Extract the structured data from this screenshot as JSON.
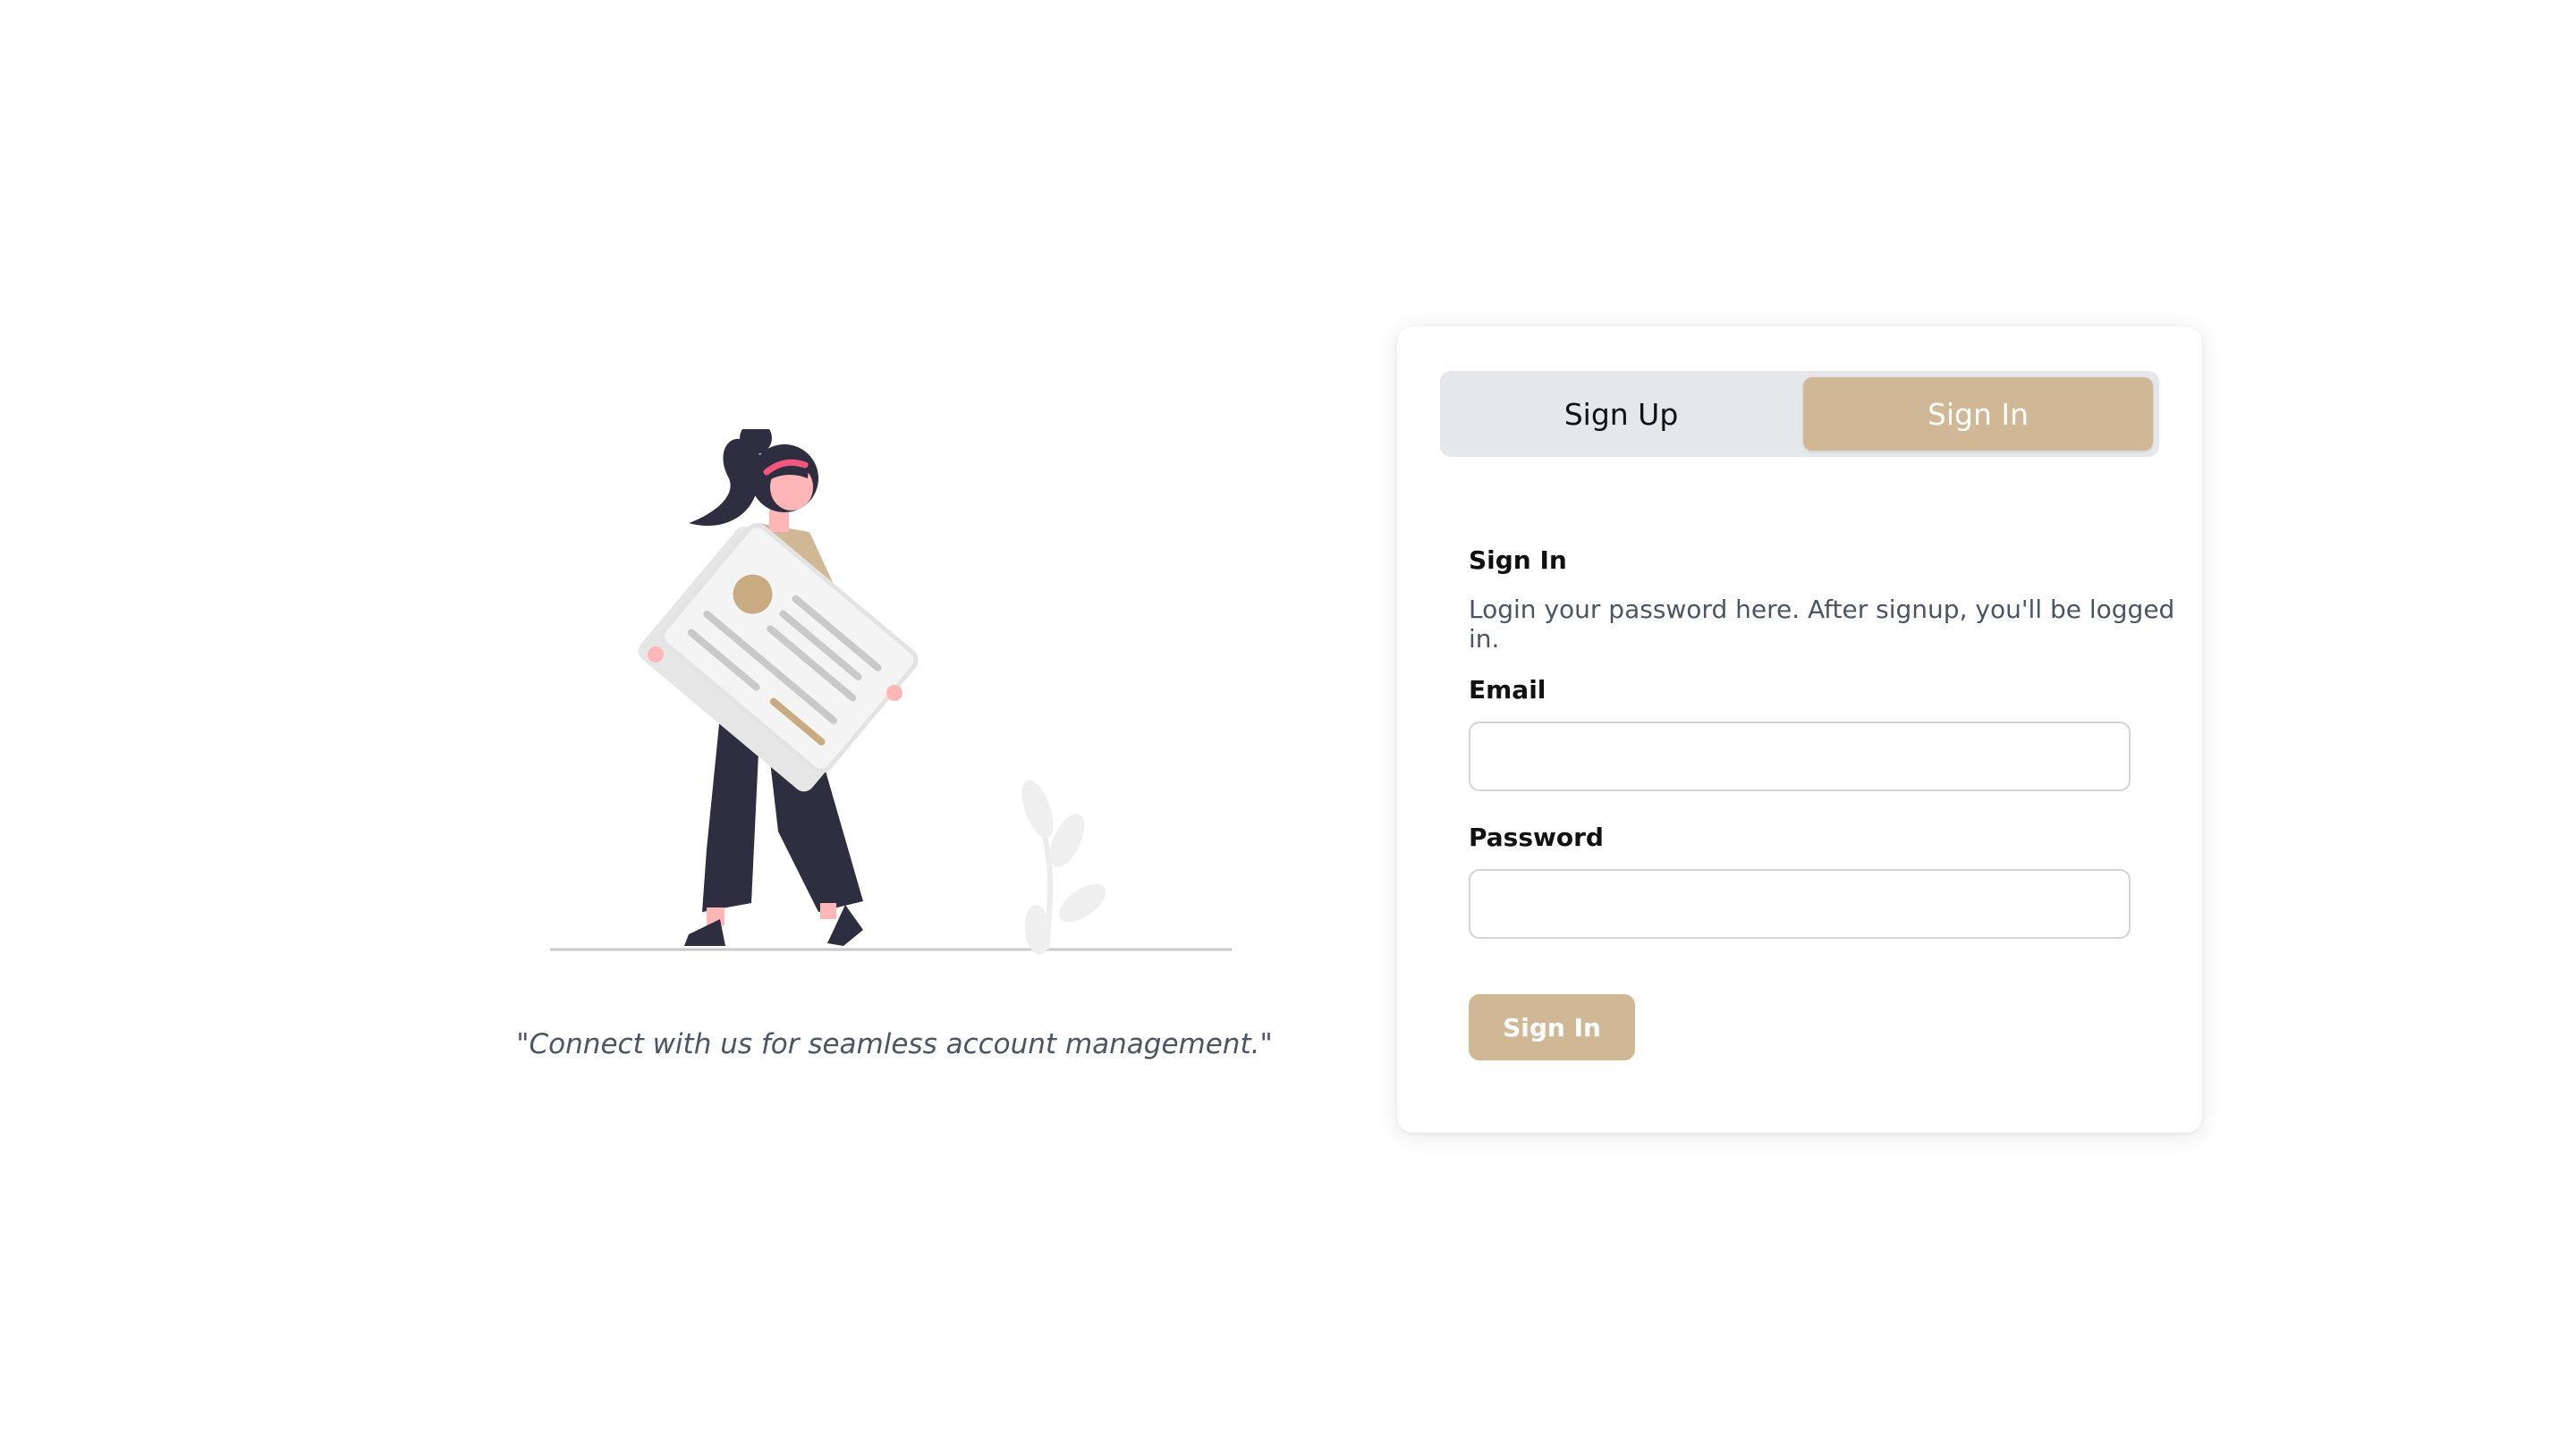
{
  "tabs": [
    {
      "label": "Sign Up",
      "active": false
    },
    {
      "label": "Sign In",
      "active": true
    }
  ],
  "form": {
    "title": "Sign In",
    "description": "Login your password here. After signup, you'll be logged in.",
    "email_label": "Email",
    "email_value": "",
    "password_label": "Password",
    "password_value": "",
    "submit_label": "Sign In"
  },
  "hero": {
    "quote": "\"Connect with us for seamless account management.\"",
    "illustration_icon": "woman-holding-document-illustration"
  },
  "colors": {
    "accent": "#d0b897",
    "tab_bar_bg": "#e6e7eb",
    "figure_dark": "#2f2e41",
    "accent_pink": "#f5577c",
    "text_muted": "#4b5563"
  }
}
